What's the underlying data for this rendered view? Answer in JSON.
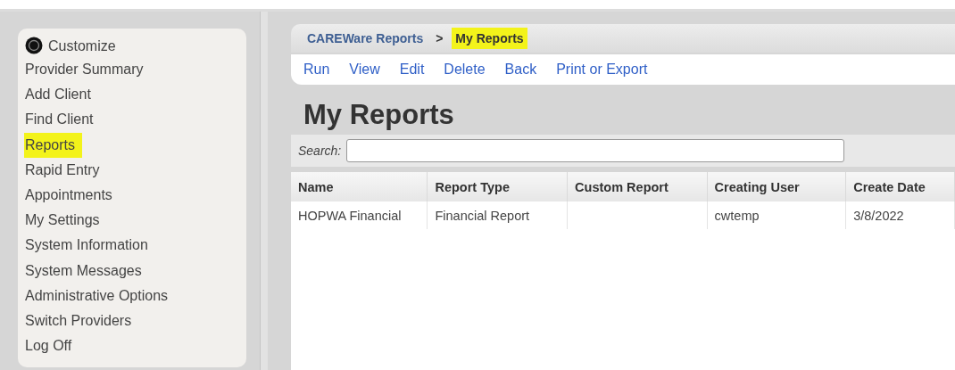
{
  "sidebar": {
    "customize": "Customize",
    "items": [
      {
        "label": "Provider Summary",
        "highlighted": false
      },
      {
        "label": "Add Client",
        "highlighted": false
      },
      {
        "label": "Find Client",
        "highlighted": false
      },
      {
        "label": "Reports",
        "highlighted": true
      },
      {
        "label": "Rapid Entry",
        "highlighted": false
      },
      {
        "label": "Appointments",
        "highlighted": false
      },
      {
        "label": "My Settings",
        "highlighted": false
      },
      {
        "label": "System Information",
        "highlighted": false
      },
      {
        "label": "System Messages",
        "highlighted": false
      },
      {
        "label": "Administrative Options",
        "highlighted": false
      },
      {
        "label": "Switch Providers",
        "highlighted": false
      },
      {
        "label": "Log Off",
        "highlighted": false
      }
    ]
  },
  "breadcrumb": [
    {
      "label": "CAREWare Reports",
      "highlighted": false
    },
    {
      "label": ">",
      "kind": "separator",
      "highlighted": false
    },
    {
      "label": "My Reports",
      "highlighted": true
    }
  ],
  "toolbar": [
    "Run",
    "View",
    "Edit",
    "Delete",
    "Back",
    "Print or Export"
  ],
  "title": "My Reports",
  "search": {
    "label": "Search:"
  },
  "table": {
    "columns": [
      "Name",
      "Report Type",
      "Custom Report",
      "Creating User",
      "Create Date"
    ],
    "rows": [
      [
        "HOPWA Financial",
        "Financial Report",
        "",
        "cwtemp",
        "3/8/2022"
      ]
    ]
  }
}
